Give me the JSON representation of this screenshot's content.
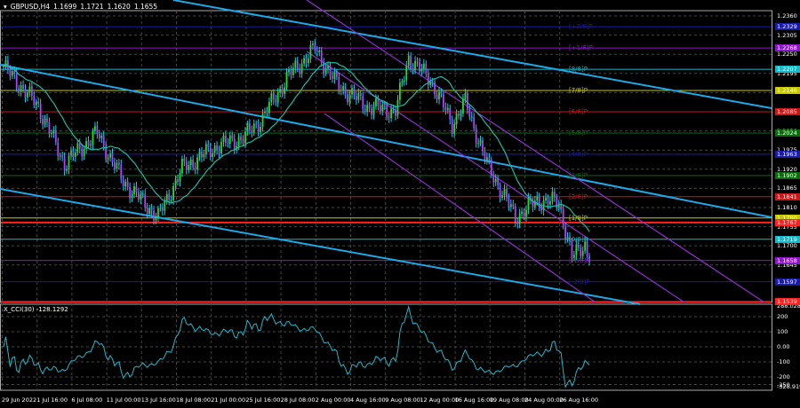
{
  "header": {
    "symbol": "GBPUSD,H4",
    "open": "1.1699",
    "high": "1.1721",
    "low": "1.1620",
    "close": "1.1655"
  },
  "price_axis": [
    "1.2360",
    "1.2305",
    "1.2250",
    "1.2195",
    "1.2140",
    "1.2085",
    "1.2030",
    "1.1975",
    "1.1920",
    "1.1865",
    "1.1810",
    "1.1755",
    "1.1700",
    "1.1645"
  ],
  "levels": [
    {
      "label": "[+2/8]P",
      "price": "1.2329",
      "value": 1.2329,
      "color": "#1a1aa8"
    },
    {
      "label": "[+1/8]P",
      "price": "1.2268",
      "value": 1.2268,
      "color": "#8a18c8"
    },
    {
      "label": "[8/8]P",
      "price": "1.2207",
      "value": 1.2207,
      "color": "#18b8c8"
    },
    {
      "label": "[7/8]P",
      "price": "1.2146",
      "value": 1.2146,
      "color": "#c8c800"
    },
    {
      "label": "[6/8]P",
      "price": "1.2085",
      "value": 1.2085,
      "color": "#c81818"
    },
    {
      "label": "[5/8]P",
      "price": "1.2024",
      "value": 1.2024,
      "color": "#0c6a0c"
    },
    {
      "label": "[4/8]P",
      "price": "1.1963",
      "value": 1.1963,
      "color": "#1a1aa8"
    },
    {
      "label": "[3/8]P",
      "price": "1.1902",
      "value": 1.1902,
      "color": "#0c6a0c"
    },
    {
      "label": "[2/8]P",
      "price": "1.1841",
      "value": 1.1841,
      "color": "#c81818"
    },
    {
      "label": "[1/8]P",
      "price": "1.1780",
      "value": 1.178,
      "color": "#c8c800"
    },
    {
      "label": "[0/8]P",
      "price": "1.1719",
      "value": 1.1719,
      "color": "#18b8c8"
    },
    {
      "label": "[-1/8]P",
      "price": "1.1658",
      "value": 1.1658,
      "color": "#8a18c8"
    },
    {
      "label": "[-2/8]P",
      "price": "1.1597",
      "value": 1.1597,
      "color": "#1a1aa8"
    }
  ],
  "support_resistance": [
    {
      "price": "1.1767",
      "value": 1.1767,
      "color": "#ff2020"
    },
    {
      "price": "1.1539",
      "value": 1.1539,
      "color": "#ff2020"
    }
  ],
  "time_axis": [
    "29 Jun 2022",
    "1 Jul 16:00",
    "6 Jul 08:00",
    "11 Jul 00:00",
    "13 Jul 16:00",
    "18 Jul 08:00",
    "21 Jul 00:00",
    "25 Jul 16:00",
    "28 Jul 08:00",
    "2 Aug 00:00",
    "4 Aug 16:00",
    "9 Aug 08:00",
    "12 Aug 00:00",
    "16 Aug 16:00",
    "19 Aug 08:00",
    "24 Aug 00:00",
    "26 Aug 16:00"
  ],
  "cci": {
    "label": "X_CCI(30) -128.1292",
    "axis": [
      "288.0284",
      "200",
      "100",
      "0.00",
      "-100",
      "-200",
      "-250",
      "-328.9199"
    ]
  },
  "chart_data": {
    "type": "candlestick",
    "title": "GBPUSD,H4",
    "ylim": [
      1.153,
      1.2375
    ],
    "price_path": [
      [
        0,
        1.2215
      ],
      [
        16,
        1.21
      ],
      [
        28,
        1.1935
      ],
      [
        43,
        1.2024
      ],
      [
        55,
        1.1884
      ],
      [
        71,
        1.1782
      ],
      [
        82,
        1.1922
      ],
      [
        98,
        1.1986
      ],
      [
        110,
        1.201
      ],
      [
        118,
        1.206
      ],
      [
        131,
        1.219
      ],
      [
        143,
        1.2266
      ],
      [
        153,
        1.2164
      ],
      [
        167,
        1.21
      ],
      [
        180,
        1.2087
      ],
      [
        186,
        1.224
      ],
      [
        196,
        1.2177
      ],
      [
        206,
        1.205
      ],
      [
        212,
        1.2113
      ],
      [
        222,
        1.1935
      ],
      [
        235,
        1.1782
      ],
      [
        245,
        1.183
      ],
      [
        255,
        1.1825
      ],
      [
        261,
        1.1667
      ],
      [
        267,
        1.1706
      ],
      [
        269,
        1.1655
      ]
    ],
    "moving_average_period": 20,
    "indicator": "CCI(30)",
    "indicator_ylim": [
      -328.9199,
      288.0284
    ]
  }
}
